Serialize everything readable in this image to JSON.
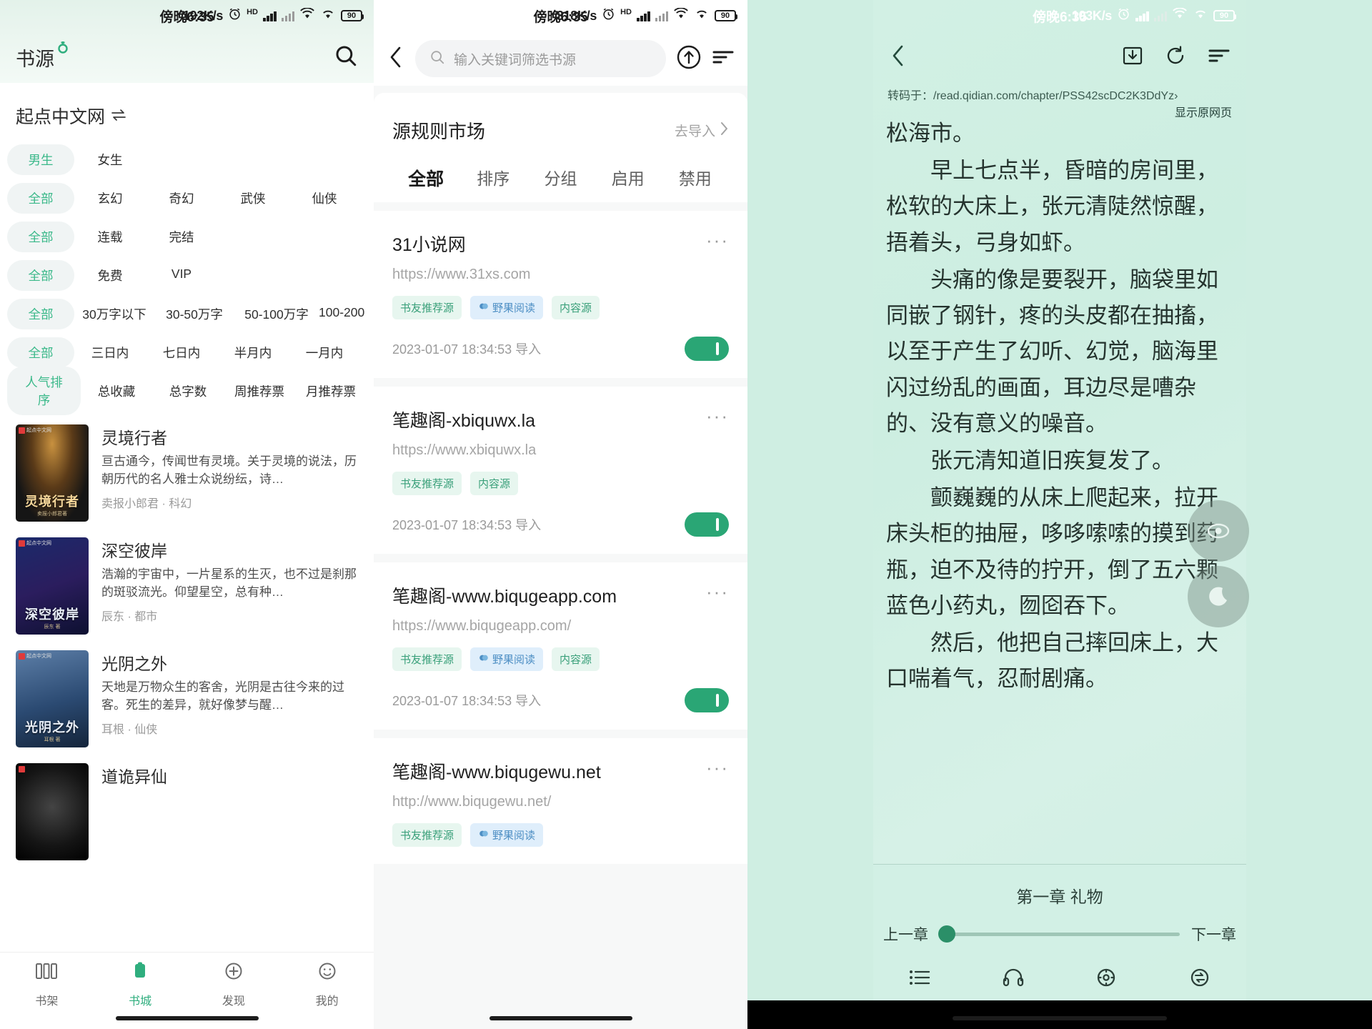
{
  "panel1": {
    "status": {
      "time": "傍晚6:35",
      "speed": "192K/s",
      "hd": "HD",
      "battery": "90"
    },
    "header": {
      "title": "书源",
      "search_icon": "search-icon"
    },
    "source": {
      "name": "起点中文网",
      "switch_icon": "swap-icon"
    },
    "filters": [
      {
        "selected": "男生",
        "options": [
          "女生"
        ]
      },
      {
        "selected": "全部",
        "options": [
          "玄幻",
          "奇幻",
          "武侠",
          "仙侠"
        ]
      },
      {
        "selected": "全部",
        "options": [
          "连载",
          "完结"
        ]
      },
      {
        "selected": "全部",
        "options": [
          "免费",
          "VIP"
        ]
      },
      {
        "selected": "全部",
        "options": [
          "30万字以下",
          "30-50万字",
          "50-100万字",
          "100-200"
        ]
      },
      {
        "selected": "全部",
        "options": [
          "三日内",
          "七日内",
          "半月内",
          "一月内"
        ]
      },
      {
        "selected": "人气排序",
        "options": [
          "总收藏",
          "总字数",
          "周推荐票",
          "月推荐票"
        ]
      }
    ],
    "books": [
      {
        "title": "灵境行者",
        "desc": "亘古通今，传闻世有灵境。关于灵境的说法，历朝历代的名人雅士众说纷纭，诗…",
        "author": "卖报小郎君",
        "category": "科幻",
        "cover_text": "灵境行者",
        "cover_sub": "卖报小郎君著"
      },
      {
        "title": "深空彼岸",
        "desc": "浩瀚的宇宙中，一片星系的生灭，也不过是刹那的斑驳流光。仰望星空，总有种…",
        "author": "辰东",
        "category": "都市",
        "cover_text": "深空彼岸",
        "cover_sub": "辰东 著"
      },
      {
        "title": "光阴之外",
        "desc": "天地是万物众生的客舍，光阴是古往今来的过客。死生的差异，就好像梦与醒…",
        "author": "耳根",
        "category": "仙侠",
        "cover_text": "光阴之外",
        "cover_sub": "耳根 著"
      },
      {
        "title": "道诡异仙",
        "desc": "",
        "author": "",
        "category": "",
        "cover_text": "",
        "cover_sub": ""
      }
    ],
    "nav": [
      {
        "label": "书架",
        "icon": "bookshelf-icon",
        "active": false
      },
      {
        "label": "书城",
        "icon": "bookstore-icon",
        "active": true
      },
      {
        "label": "发现",
        "icon": "discover-icon",
        "active": false
      },
      {
        "label": "我的",
        "icon": "profile-icon",
        "active": false
      }
    ]
  },
  "panel2": {
    "status": {
      "time": "傍晚6:35",
      "speed": "318K/s",
      "hd": "HD",
      "battery": "90"
    },
    "header": {
      "back_icon": "back-chevron-icon",
      "search_placeholder": "输入关键词筛选书源",
      "search_value": "",
      "upload_icon": "upload-circle-icon",
      "menu_icon": "sort-lines-icon"
    },
    "market": {
      "title": "源规则市场",
      "import_label": "去导入"
    },
    "tabs": [
      {
        "label": "全部",
        "active": true
      },
      {
        "label": "排序",
        "active": false
      },
      {
        "label": "分组",
        "active": false
      },
      {
        "label": "启用",
        "active": false
      },
      {
        "label": "禁用",
        "active": false
      }
    ],
    "sources": [
      {
        "name": "31小说网",
        "url": "https://www.31xs.com",
        "tags": [
          {
            "label": "书友推荐源",
            "style": "green"
          },
          {
            "label": "野果阅读",
            "style": "blue",
            "icon": "app-icon"
          },
          {
            "label": "内容源",
            "style": "green"
          }
        ],
        "date": "2023-01-07 18:34:53 导入",
        "enabled": true
      },
      {
        "name": "笔趣阁-xbiquwx.la",
        "url": "https://www.xbiquwx.la",
        "tags": [
          {
            "label": "书友推荐源",
            "style": "green"
          },
          {
            "label": "内容源",
            "style": "green"
          }
        ],
        "date": "2023-01-07 18:34:53 导入",
        "enabled": true
      },
      {
        "name": "笔趣阁-www.biqugeapp.com",
        "url": "https://www.biqugeapp.com/",
        "tags": [
          {
            "label": "书友推荐源",
            "style": "green"
          },
          {
            "label": "野果阅读",
            "style": "blue",
            "icon": "app-icon"
          },
          {
            "label": "内容源",
            "style": "green"
          }
        ],
        "date": "2023-01-07 18:34:53 导入",
        "enabled": true
      },
      {
        "name": "笔趣阁-www.biqugewu.net",
        "url": "http://www.biqugewu.net/",
        "tags": [
          {
            "label": "书友推荐源",
            "style": "green"
          },
          {
            "label": "野果阅读",
            "style": "blue",
            "icon": "app-icon"
          }
        ],
        "date": "",
        "enabled": true
      }
    ]
  },
  "panel3": {
    "status": {
      "time": "傍晚6:35",
      "speed": "103K/s",
      "battery": "90"
    },
    "header": {
      "back_icon": "back-chevron-icon",
      "download_icon": "download-icon",
      "refresh_icon": "refresh-icon",
      "menu_icon": "sort-lines-icon"
    },
    "transcode": {
      "prefix": "转码于：",
      "url": "/read.qidian.com/chapter/PSS42scDC2K3DdYz",
      "chevron": "›",
      "original_label": "显示原网页"
    },
    "content": [
      "松海市。",
      "早上七点半，昏暗的房间里，松软的大床上，张元清陡然惊醒，捂着头，弓身如虾。",
      "头痛的像是要裂开，脑袋里如同嵌了钢针，疼的头皮都在抽搐，以至于产生了幻听、幻觉，脑海里闪过纷乱的画面，耳边尽是嘈杂的、没有意义的噪音。",
      "张元清知道旧疾复发了。",
      "颤巍巍的从床上爬起来，拉开床头柜的抽屉，哆哆嗦嗦的摸到药瓶，迫不及待的拧开，倒了五六颗蓝色小药丸，囫囵吞下。",
      "然后，他把自己摔回床上，大口喘着气，忍耐剧痛。"
    ],
    "fabs": [
      {
        "icon": "eye-icon"
      },
      {
        "icon": "moon-icon"
      }
    ],
    "chapter": {
      "name": "第一章 礼物",
      "prev_label": "上一章",
      "next_label": "下一章",
      "progress": 0
    },
    "nav": [
      {
        "label": "目录",
        "icon": "list-icon"
      },
      {
        "label": "听书",
        "icon": "headphones-icon"
      },
      {
        "label": "设置",
        "icon": "gear-icon"
      },
      {
        "label": "换源",
        "icon": "swap-source-icon"
      }
    ]
  }
}
